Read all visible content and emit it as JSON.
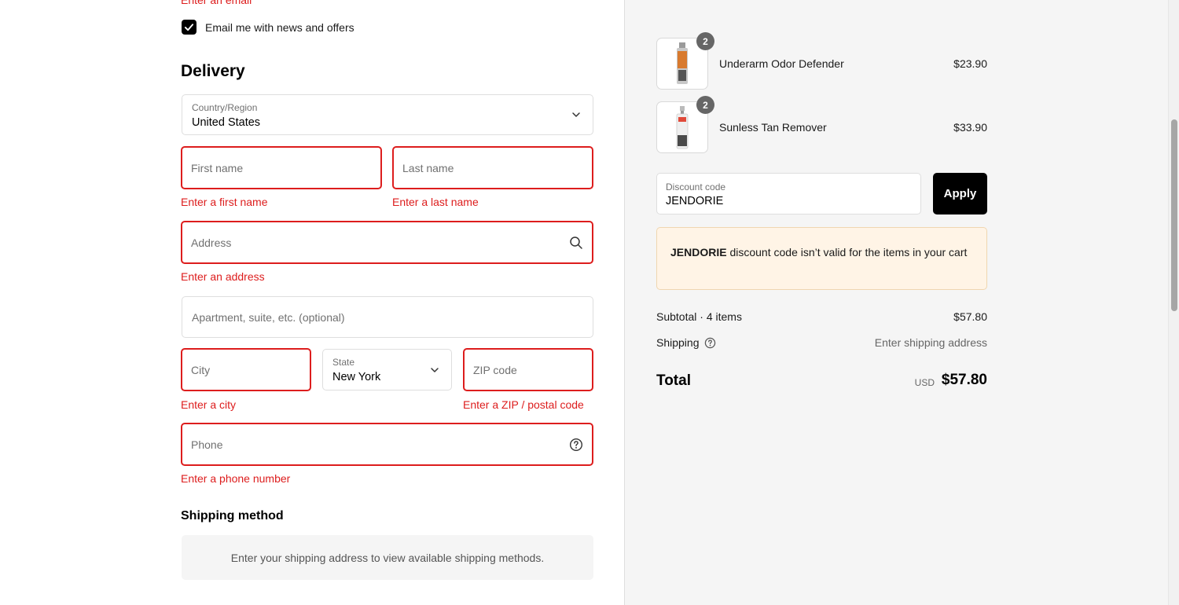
{
  "form": {
    "top_error": "Enter an email",
    "newsletter_label": "Email me with news and offers",
    "delivery_heading": "Delivery",
    "country": {
      "label": "Country/Region",
      "value": "United States"
    },
    "first_name": {
      "placeholder": "First name",
      "error": "Enter a first name"
    },
    "last_name": {
      "placeholder": "Last name",
      "error": "Enter a last name"
    },
    "address": {
      "placeholder": "Address",
      "error": "Enter an address"
    },
    "apartment": {
      "placeholder": "Apartment, suite, etc. (optional)"
    },
    "city": {
      "placeholder": "City",
      "error": "Enter a city"
    },
    "state": {
      "label": "State",
      "value": "New York"
    },
    "zip": {
      "placeholder": "ZIP code",
      "error": "Enter a ZIP / postal code"
    },
    "phone": {
      "placeholder": "Phone",
      "error": "Enter a phone number"
    },
    "shipping_heading": "Shipping method",
    "shipping_notice": "Enter your shipping address to view available shipping methods."
  },
  "summary": {
    "items": [
      {
        "name": "Underarm Odor Defender",
        "price": "$23.90",
        "quantity": "2"
      },
      {
        "name": "Sunless Tan Remover",
        "price": "$33.90",
        "quantity": "2"
      }
    ],
    "discount": {
      "label": "Discount code",
      "value": "JENDORIE",
      "apply_label": "Apply"
    },
    "notice": {
      "code": "JENDORIE",
      "text": " discount code isn’t valid for the items in your cart"
    },
    "subtotal_label": "Subtotal · 4 items",
    "subtotal_value": "$57.80",
    "shipping_label": "Shipping",
    "shipping_value": "Enter shipping address",
    "total_label": "Total",
    "total_currency": "USD",
    "total_value": "$57.80"
  },
  "colors": {
    "error": "#dd1d1d",
    "accent": "#000000",
    "notice_bg": "#fff4e6"
  }
}
